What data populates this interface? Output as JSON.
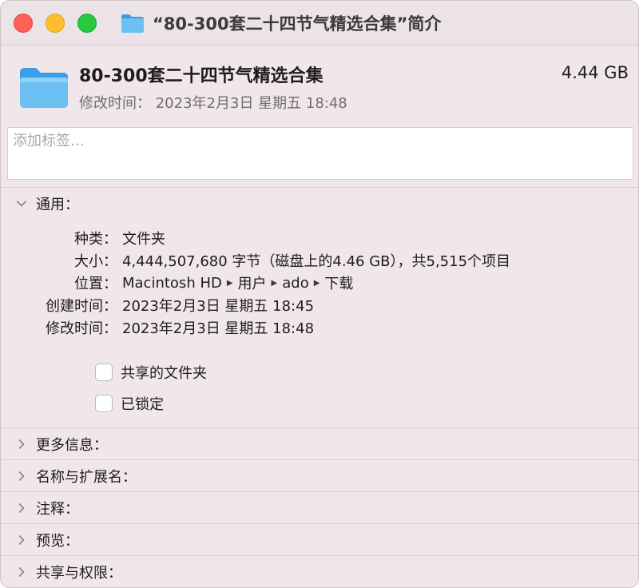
{
  "window": {
    "title": "“80-300套二十四节气精选合集”简介"
  },
  "header": {
    "name": "80-300套二十四节气精选合集",
    "size": "4.44 GB",
    "modified_label": "修改时间：",
    "modified_value": "2023年2月3日 星期五 18:48"
  },
  "tags": {
    "placeholder": "添加标签…"
  },
  "general": {
    "label": "通用：",
    "rows": {
      "kind": {
        "k": "种类：",
        "v": "文件夹"
      },
      "size": {
        "k": "大小：",
        "v": "4,444,507,680 字节（磁盘上的4.46 GB），共5,515个项目"
      },
      "where": {
        "k": "位置：",
        "path": [
          "Macintosh HD",
          "用户",
          "ado",
          "下载"
        ]
      },
      "created": {
        "k": "创建时间：",
        "v": "2023年2月3日 星期五 18:45"
      },
      "modified": {
        "k": "修改时间：",
        "v": "2023年2月3日 星期五 18:48"
      }
    },
    "checkboxes": {
      "shared": {
        "label": "共享的文件夹",
        "checked": false
      },
      "locked": {
        "label": "已锁定",
        "checked": false
      }
    }
  },
  "sections": {
    "more_info": "更多信息：",
    "name_ext": "名称与扩展名：",
    "comments": "注释：",
    "preview": "预览：",
    "sharing": "共享与权限："
  },
  "colors": {
    "folder_light": "#6cc0f4",
    "folder_dark": "#3a9ee8",
    "window_bg": "#f1e7ea"
  }
}
